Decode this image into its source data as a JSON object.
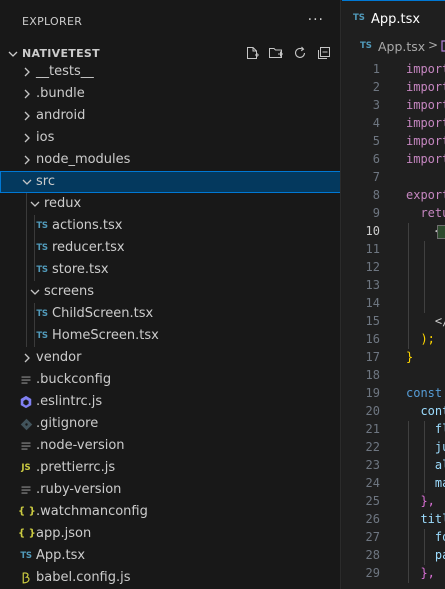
{
  "explorer": {
    "title": "EXPLORER",
    "more_label": "···",
    "project": "NATIVETEST",
    "actions": [
      "new-file-icon",
      "new-folder-icon",
      "refresh-icon",
      "collapse-all-icon"
    ],
    "tree": [
      {
        "label": "__tests__",
        "type": "folder",
        "depth": 0,
        "expanded": false
      },
      {
        "label": ".bundle",
        "type": "folder",
        "depth": 0,
        "expanded": false
      },
      {
        "label": "android",
        "type": "folder",
        "depth": 0,
        "expanded": false
      },
      {
        "label": "ios",
        "type": "folder",
        "depth": 0,
        "expanded": false
      },
      {
        "label": "node_modules",
        "type": "folder",
        "depth": 0,
        "expanded": false
      },
      {
        "label": "src",
        "type": "folder",
        "depth": 0,
        "expanded": true,
        "selected": true
      },
      {
        "label": "redux",
        "type": "folder",
        "depth": 1,
        "expanded": true
      },
      {
        "label": "actions.tsx",
        "type": "ts",
        "depth": 2
      },
      {
        "label": "reducer.tsx",
        "type": "ts",
        "depth": 2
      },
      {
        "label": "store.tsx",
        "type": "ts",
        "depth": 2
      },
      {
        "label": "screens",
        "type": "folder",
        "depth": 1,
        "expanded": true
      },
      {
        "label": "ChildScreen.tsx",
        "type": "ts",
        "depth": 2
      },
      {
        "label": "HomeScreen.tsx",
        "type": "ts",
        "depth": 2
      },
      {
        "label": "vendor",
        "type": "folder",
        "depth": 0,
        "expanded": false
      },
      {
        "label": ".buckconfig",
        "type": "text",
        "depth": 0
      },
      {
        "label": ".eslintrc.js",
        "type": "eslint",
        "depth": 0
      },
      {
        "label": ".gitignore",
        "type": "git",
        "depth": 0
      },
      {
        "label": ".node-version",
        "type": "text",
        "depth": 0
      },
      {
        "label": ".prettierrc.js",
        "type": "js",
        "depth": 0
      },
      {
        "label": ".ruby-version",
        "type": "text",
        "depth": 0
      },
      {
        "label": ".watchmanconfig",
        "type": "json",
        "depth": 0
      },
      {
        "label": "app.json",
        "type": "json",
        "depth": 0
      },
      {
        "label": "App.tsx",
        "type": "ts",
        "depth": 0
      },
      {
        "label": "babel.config.js",
        "type": "babel",
        "depth": 0
      }
    ]
  },
  "editor": {
    "tab_label": "App.tsx",
    "tab_badge": "TS",
    "breadcrumb_file": "App.tsx",
    "breadcrumb_sep": ">",
    "active_line": 10,
    "lines": [
      {
        "n": "1",
        "t": "import",
        "c": "kw-purple"
      },
      {
        "n": "2",
        "t": "import",
        "c": "kw-purple"
      },
      {
        "n": "3",
        "t": "import",
        "c": "kw-purple"
      },
      {
        "n": "4",
        "t": "import",
        "c": "kw-purple"
      },
      {
        "n": "5",
        "t": "import",
        "c": "kw-purple"
      },
      {
        "n": "6",
        "t": "import",
        "c": "kw-purple"
      },
      {
        "n": "7",
        "t": "",
        "c": ""
      },
      {
        "n": "8",
        "t": "export",
        "c": "kw-purple"
      },
      {
        "n": "9",
        "t": "  retu",
        "c": "kw-purple"
      },
      {
        "n": "10",
        "t": "    <",
        "c": "punc"
      },
      {
        "n": "11",
        "t": "",
        "c": ""
      },
      {
        "n": "12",
        "t": "",
        "c": ""
      },
      {
        "n": "13",
        "t": "",
        "c": ""
      },
      {
        "n": "14",
        "t": "",
        "c": ""
      },
      {
        "n": "15",
        "t": "    </",
        "c": "punc"
      },
      {
        "n": "16",
        "t": "  );",
        "c": "brace-y"
      },
      {
        "n": "17",
        "t": "}",
        "c": "brace-y"
      },
      {
        "n": "18",
        "t": "",
        "c": ""
      },
      {
        "n": "19",
        "t": "const",
        "c": "kw-blue"
      },
      {
        "n": "20",
        "t": "  cont",
        "c": "prop"
      },
      {
        "n": "21",
        "t": "    fl",
        "c": "prop"
      },
      {
        "n": "22",
        "t": "    ju",
        "c": "prop"
      },
      {
        "n": "23",
        "t": "    al",
        "c": "prop"
      },
      {
        "n": "24",
        "t": "    ma",
        "c": "prop"
      },
      {
        "n": "25",
        "t": "  },",
        "c": "brace"
      },
      {
        "n": "26",
        "t": "  titl",
        "c": "prop"
      },
      {
        "n": "27",
        "t": "    fo",
        "c": "prop"
      },
      {
        "n": "28",
        "t": "    pa",
        "c": "prop"
      },
      {
        "n": "29",
        "t": "  },",
        "c": "brace"
      }
    ]
  }
}
